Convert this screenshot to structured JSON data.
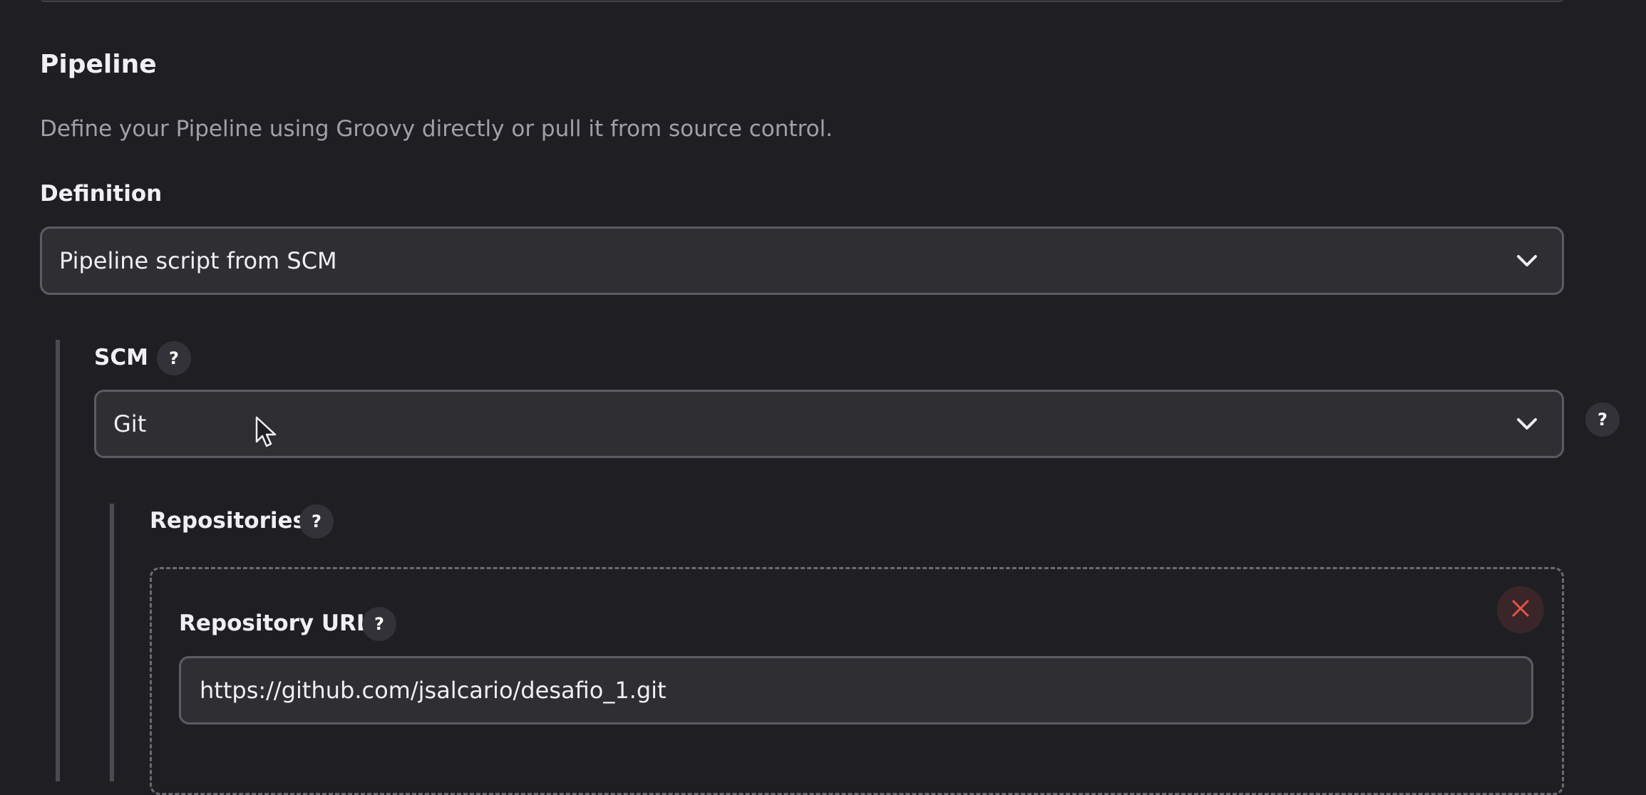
{
  "pipeline": {
    "title": "Pipeline",
    "description": "Define your Pipeline using Groovy directly or pull it from source control."
  },
  "definition": {
    "label": "Definition",
    "selected": "Pipeline script from SCM"
  },
  "scm": {
    "label": "SCM",
    "selected": "Git",
    "help_glyph": "?"
  },
  "repositories": {
    "label": "Repositories",
    "help_glyph": "?",
    "repository_url": {
      "label": "Repository URL",
      "value": "https://github.com/jsalcario/desafio_1.git",
      "help_glyph": "?"
    }
  },
  "icons": {
    "chevron": "chevron-down-icon",
    "help": "question-mark-icon",
    "delete": "close-icon",
    "cursor": "mouse-pointer-icon"
  },
  "colors": {
    "background": "#1f1f23",
    "field_background": "#2e2e33",
    "field_border": "#5c5c64",
    "muted_text": "#a0a0aa",
    "delete_red": "#e5534b"
  }
}
